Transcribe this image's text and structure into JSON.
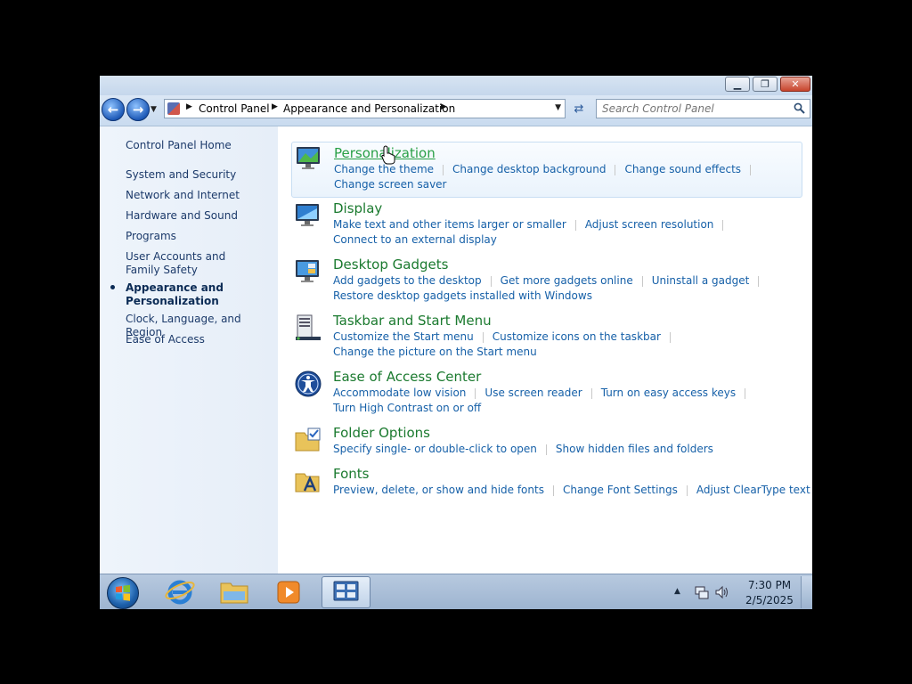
{
  "window": {
    "controls": {
      "minimize": "▁",
      "maximize": "❐",
      "close": "✕"
    }
  },
  "nav": {
    "back_icon": "arrow-left-icon",
    "forward_icon": "arrow-right-icon",
    "breadcrumbs": [
      "Control Panel",
      "Appearance and Personalization"
    ],
    "search_placeholder": "Search Control Panel"
  },
  "sidebar": {
    "home": "Control Panel Home",
    "items": [
      {
        "label": "System and Security"
      },
      {
        "label": "Network and Internet"
      },
      {
        "label": "Hardware and Sound"
      },
      {
        "label": "Programs"
      },
      {
        "label": "User Accounts and Family Safety"
      },
      {
        "label": "Appearance and Personalization",
        "active": true
      },
      {
        "label": "Clock, Language, and Region"
      },
      {
        "label": "Ease of Access"
      }
    ]
  },
  "categories": [
    {
      "title": "Personalization",
      "icon": "personalization-icon",
      "links": [
        "Change the theme",
        "Change desktop background",
        "Change sound effects",
        "Change screen saver"
      ]
    },
    {
      "title": "Display",
      "icon": "display-icon",
      "links": [
        "Make text and other items larger or smaller",
        "Adjust screen resolution",
        "Connect to an external display"
      ]
    },
    {
      "title": "Desktop Gadgets",
      "icon": "gadgets-icon",
      "links": [
        "Add gadgets to the desktop",
        "Get more gadgets online",
        "Uninstall a gadget",
        "Restore desktop gadgets installed with Windows"
      ]
    },
    {
      "title": "Taskbar and Start Menu",
      "icon": "taskbar-icon",
      "links": [
        "Customize the Start menu",
        "Customize icons on the taskbar",
        "Change the picture on the Start menu"
      ]
    },
    {
      "title": "Ease of Access Center",
      "icon": "ease-of-access-icon",
      "links": [
        "Accommodate low vision",
        "Use screen reader",
        "Turn on easy access keys",
        "Turn High Contrast on or off"
      ]
    },
    {
      "title": "Folder Options",
      "icon": "folder-options-icon",
      "links": [
        "Specify single- or double-click to open",
        "Show hidden files and folders"
      ]
    },
    {
      "title": "Fonts",
      "icon": "fonts-icon",
      "links": [
        "Preview, delete, or show and hide fonts",
        "Change Font Settings",
        "Adjust ClearType text"
      ]
    }
  ],
  "taskbar": {
    "apps": [
      "start-orb-icon",
      "internet-explorer-icon",
      "windows-explorer-icon",
      "media-player-icon",
      "control-panel-icon"
    ],
    "clock_time": "7:30 PM",
    "clock_date": "2/5/2025"
  },
  "colors": {
    "link": "#1660a8",
    "category_title": "#1b7a2f",
    "sidebar_text": "#1c3a6a"
  }
}
